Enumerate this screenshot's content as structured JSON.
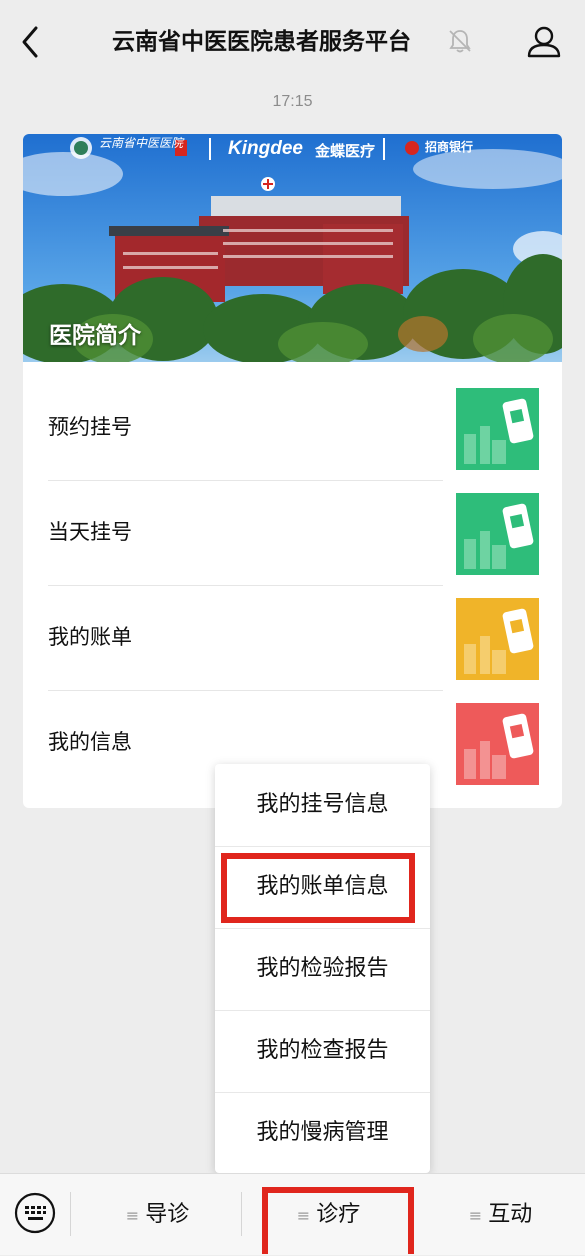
{
  "header": {
    "title": "云南省中医医院患者服务平台",
    "back_icon": "chevron-left-icon",
    "mute_icon": "bell-muted-icon",
    "profile_icon": "user-icon"
  },
  "timestamp": "17:15",
  "card": {
    "banner_title": "医院简介",
    "brand_kingdee": "Kingdee",
    "brand_kingdee_cn": "金蝶医疗",
    "hospital_logo_text": "云南省中医医院",
    "bank_logo_text": "招商银行",
    "items": [
      {
        "label": "预约挂号",
        "thumb_color": "#2ebd7a"
      },
      {
        "label": "当天挂号",
        "thumb_color": "#2ebd7a"
      },
      {
        "label": "我的账单",
        "thumb_color": "#f0b429"
      },
      {
        "label": "我的信息",
        "thumb_color": "#ee5a5a"
      }
    ]
  },
  "popup_menu": {
    "items": [
      {
        "label": "我的挂号信息"
      },
      {
        "label": "我的账单信息"
      },
      {
        "label": "我的检验报告"
      },
      {
        "label": "我的检查报告"
      },
      {
        "label": "我的慢病管理"
      }
    ],
    "highlighted_index": 1,
    "highlight_color": "#e0261d"
  },
  "bottom_menu": {
    "keyboard_icon": "keyboard-icon",
    "items": [
      {
        "label": "导诊"
      },
      {
        "label": "诊疗"
      },
      {
        "label": "互动"
      }
    ],
    "highlighted_index": 1
  }
}
